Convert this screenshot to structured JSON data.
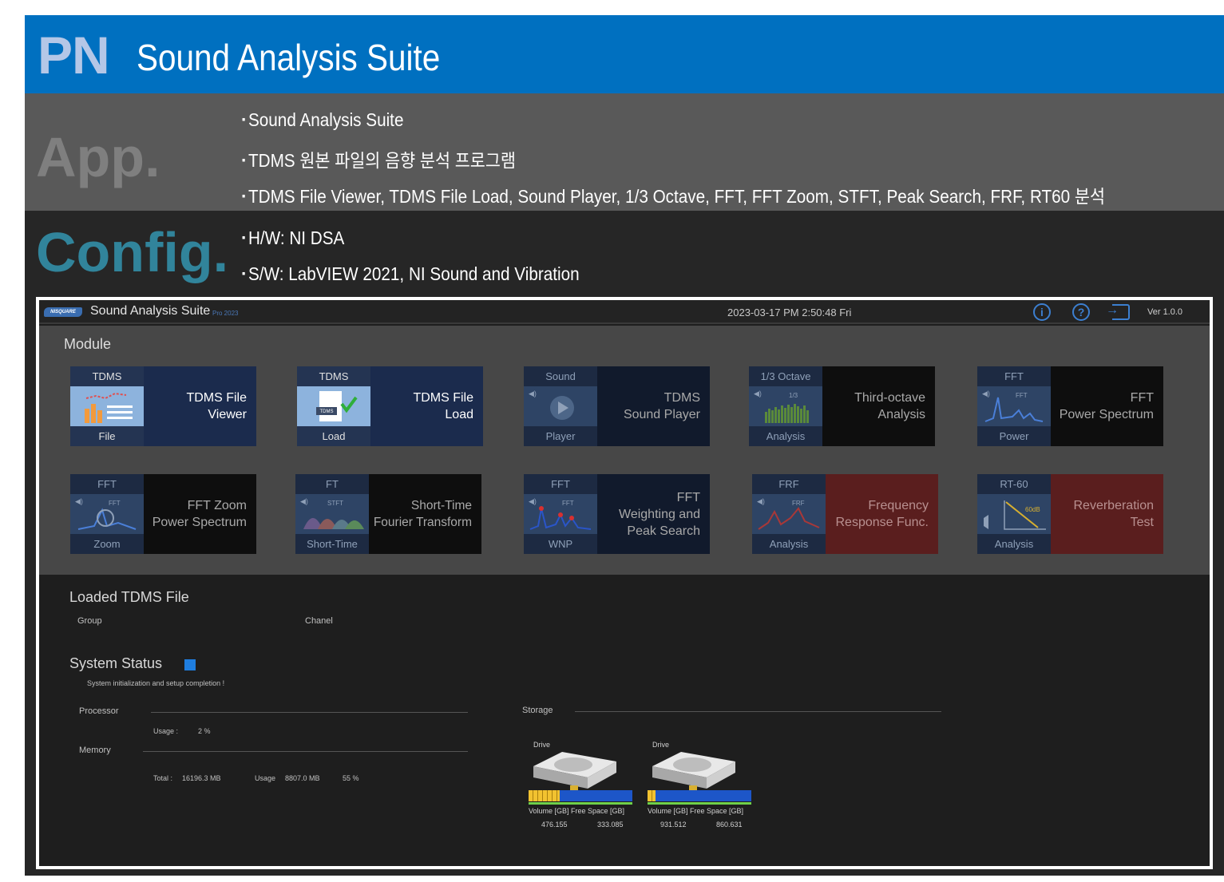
{
  "header": {
    "code": "PN",
    "title": "Sound Analysis Suite"
  },
  "app_section": {
    "label": "App.",
    "bullets": [
      "Sound Analysis Suite",
      "TDMS 원본 파일의 음향 분석 프로그램",
      "TDMS File Viewer, TDMS File Load,  Sound Player, 1/3 Octave, FFT, FFT Zoom, STFT, Peak Search, FRF, RT60 분석"
    ]
  },
  "config_section": {
    "label": "Config.",
    "bullets": [
      "H/W: NI DSA",
      "S/W: LabVIEW 2021, NI Sound and Vibration"
    ]
  },
  "app": {
    "logo_text": "NISQUARE",
    "title": "Sound Analysis Suite",
    "edition": "Pro 2023",
    "datetime": "2023-03-17 PM 2:50:48 Fri",
    "version": "Ver 1.0.0",
    "icons": [
      "info-icon",
      "help-icon",
      "exit-icon"
    ],
    "module_label": "Module",
    "tiles": [
      {
        "top": "TDMS",
        "bottom": "File",
        "label": "TDMS File\nViewer",
        "style": "active"
      },
      {
        "top": "TDMS",
        "bottom": "Load",
        "label": "TDMS File\nLoad",
        "style": "active"
      },
      {
        "top": "Sound",
        "bottom": "Player",
        "label": "TDMS\nSound Player",
        "style": "dim"
      },
      {
        "top": "1/3 Octave",
        "bottom": "Analysis",
        "label": "Third-octave\nAnalysis",
        "style": "black"
      },
      {
        "top": "FFT",
        "bottom": "Power",
        "label": "FFT\nPower Spectrum",
        "style": "black"
      },
      {
        "top": "FFT",
        "bottom": "Zoom",
        "label": "FFT Zoom\nPower Spectrum",
        "style": "black"
      },
      {
        "top": "FT",
        "bottom": "Short-Time",
        "label": "Short-Time\nFourier Transform",
        "style": "black"
      },
      {
        "top": "FFT",
        "bottom": "WNP",
        "label": "FFT\nWeighting and\nPeak Search",
        "style": "dim"
      },
      {
        "top": "FRF",
        "bottom": "Analysis",
        "label": "Frequency\nResponse Func.",
        "style": "red"
      },
      {
        "top": "RT-60",
        "bottom": "Analysis",
        "label": "Reverberation\nTest",
        "style": "red"
      }
    ],
    "tile_art_text": [
      "TDMS",
      "1/3",
      "FFT",
      "FFT",
      "STFT",
      "FFT",
      "FRF",
      "60dB"
    ],
    "loaded": {
      "title": "Loaded TDMS File",
      "group_label": "Group",
      "channel_label": "Chanel"
    },
    "status": {
      "title": "System Status",
      "message": "System initialization and setup completion !",
      "processor_label": "Processor",
      "usage_label": "Usage :",
      "usage_value": "2 %",
      "memory_label": "Memory",
      "total_label": "Total :",
      "total_value": "16196.3 MB",
      "mem_usage_label": "Usage",
      "mem_usage_value": "8807.0 MB",
      "mem_percent": "55 %",
      "storage_label": "Storage"
    },
    "drives": [
      {
        "label": "Drive",
        "caption": "Volume [GB] Free Space [GB]",
        "volume": "476.155",
        "free": "333.085",
        "used_fraction": 0.3
      },
      {
        "label": "Drive",
        "caption": "Volume [GB] Free Space [GB]",
        "volume": "931.512",
        "free": "860.631",
        "used_fraction": 0.08
      }
    ],
    "colors": {
      "accent": "#1f7ee0",
      "header_blue": "#0070c0",
      "teal": "#31849b"
    }
  }
}
